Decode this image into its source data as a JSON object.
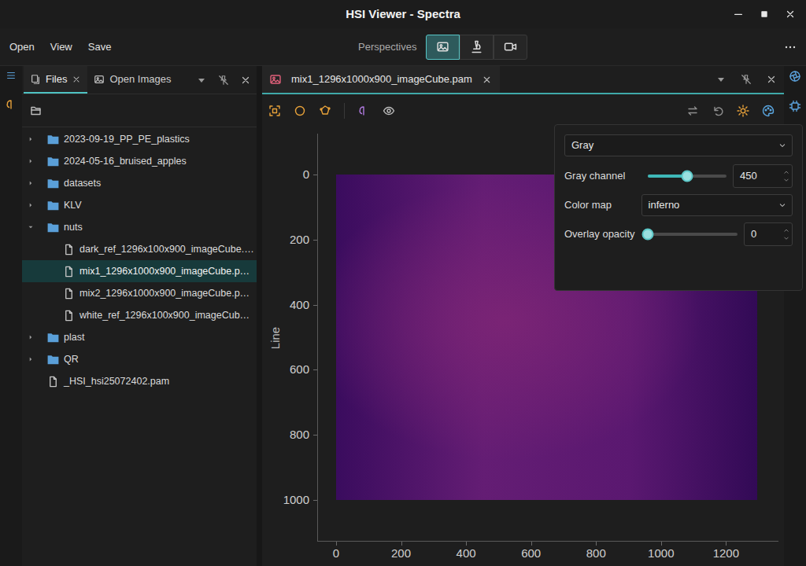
{
  "window": {
    "title": "HSI Viewer - Spectra"
  },
  "menu": [
    {
      "label": "Open"
    },
    {
      "label": "View"
    },
    {
      "label": "Save"
    }
  ],
  "perspectives": {
    "label": "Perspectives",
    "items": [
      {
        "kind": "image",
        "selected": true
      },
      {
        "kind": "probe",
        "selected": false
      },
      {
        "kind": "video",
        "selected": false
      }
    ]
  },
  "left_panel": {
    "tabs": [
      {
        "label": "Files",
        "kind": "files",
        "selected": true
      },
      {
        "label": "Open Images",
        "kind": "images",
        "selected": false
      }
    ],
    "tree": [
      {
        "label": "2023-09-19_PP_PE_plastics",
        "kind": "folder",
        "depth": 0,
        "expanded": false,
        "selected": false
      },
      {
        "label": "2024-05-16_bruised_apples",
        "kind": "folder",
        "depth": 0,
        "expanded": false,
        "selected": false
      },
      {
        "label": "datasets",
        "kind": "folder",
        "depth": 0,
        "expanded": false,
        "selected": false
      },
      {
        "label": "KLV",
        "kind": "folder",
        "depth": 0,
        "expanded": false,
        "selected": false
      },
      {
        "label": "nuts",
        "kind": "folder",
        "depth": 0,
        "expanded": true,
        "selected": false
      },
      {
        "label": "dark_ref_1296x100x900_imageCube.…",
        "kind": "file",
        "depth": 1,
        "expanded": false,
        "selected": false
      },
      {
        "label": "mix1_1296x1000x900_imageCube.p…",
        "kind": "file",
        "depth": 1,
        "expanded": false,
        "selected": true
      },
      {
        "label": "mix2_1296x1000x900_imageCube.p…",
        "kind": "file",
        "depth": 1,
        "expanded": false,
        "selected": false
      },
      {
        "label": "white_ref_1296x100x900_imageCub…",
        "kind": "file",
        "depth": 1,
        "expanded": false,
        "selected": false
      },
      {
        "label": "plast",
        "kind": "folder",
        "depth": 0,
        "expanded": false,
        "selected": false
      },
      {
        "label": "QR",
        "kind": "folder",
        "depth": 0,
        "expanded": false,
        "selected": false
      },
      {
        "label": "_HSI_hsi25072402.pam",
        "kind": "file",
        "depth": 0,
        "expanded": false,
        "selected": false
      }
    ]
  },
  "image_tab": {
    "label": "mix1_1296x1000x900_imageCube.pam",
    "selected": true
  },
  "plot": {
    "y_label": "Line",
    "y_ticks": [
      "0",
      "200",
      "400",
      "600",
      "800",
      "1000"
    ],
    "x_ticks": [
      "0",
      "200",
      "400",
      "600",
      "800",
      "1000",
      "1200"
    ]
  },
  "display_popup": {
    "mode": "Gray",
    "gray_channel": {
      "label": "Gray channel",
      "level": 0.5,
      "value": "450"
    },
    "color_map": {
      "label": "Color map",
      "value": "inferno"
    },
    "overlay_opacity": {
      "label": "Overlay opacity",
      "level": 0,
      "value": "0"
    }
  }
}
